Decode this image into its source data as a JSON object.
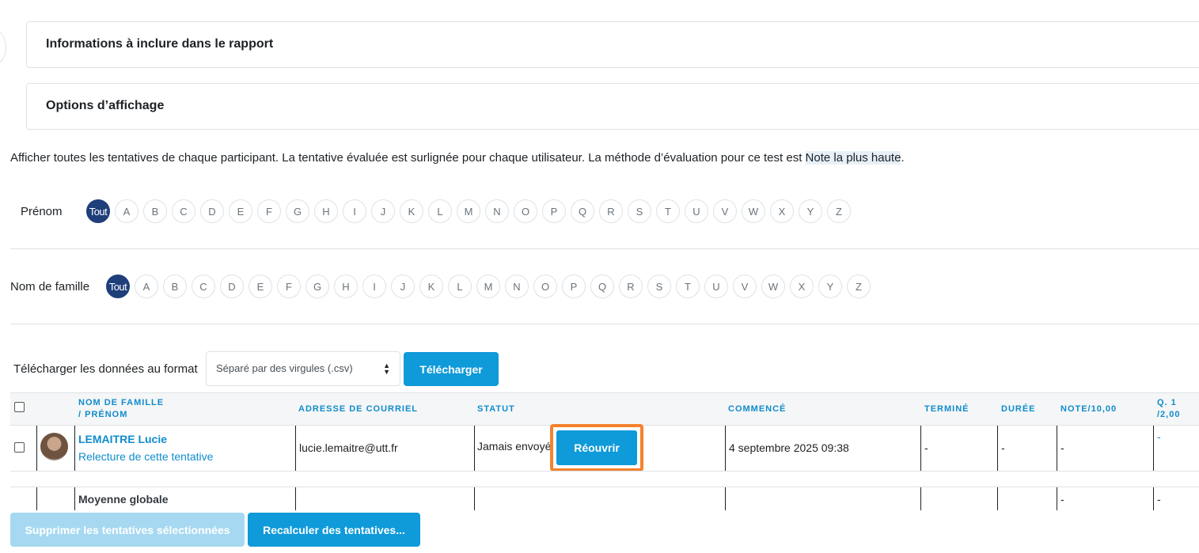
{
  "sections": [
    {
      "title": "Informations à inclure dans le rapport"
    },
    {
      "title": "Options d’affichage"
    }
  ],
  "description": {
    "text": "Afficher toutes les tentatives de chaque participant. La tentative évaluée est surlignée pour chaque utilisateur. La méthode d’évaluation pour ce test est ",
    "highlight": "Note la plus haute",
    "end": "."
  },
  "initials_firstname": {
    "label": "Prénom",
    "all": "Tout",
    "letters": [
      "A",
      "B",
      "C",
      "D",
      "E",
      "F",
      "G",
      "H",
      "I",
      "J",
      "K",
      "L",
      "M",
      "N",
      "O",
      "P",
      "Q",
      "R",
      "S",
      "T",
      "U",
      "V",
      "W",
      "X",
      "Y",
      "Z"
    ]
  },
  "initials_lastname": {
    "label": "Nom de famille",
    "all": "Tout",
    "letters": [
      "A",
      "B",
      "C",
      "D",
      "E",
      "F",
      "G",
      "H",
      "I",
      "J",
      "K",
      "L",
      "M",
      "N",
      "O",
      "P",
      "Q",
      "R",
      "S",
      "T",
      "U",
      "V",
      "W",
      "X",
      "Y",
      "Z"
    ]
  },
  "download": {
    "label": "Télécharger les données au format",
    "format": "Séparé par des virgules (.csv)",
    "button": "Télécharger"
  },
  "table": {
    "headers": {
      "lastname": "NOM DE FAMILLE",
      "firstname": "/ PRÉNOM",
      "email": "ADRESSE DE COURRIEL",
      "status": "STATUT",
      "started": "COMMENCÉ",
      "finished": "TERMINÉ",
      "duration": "DURÉE",
      "grade": "NOTE/10,00",
      "q1_top": "Q. 1",
      "q1_bottom": "/2,00"
    },
    "row": {
      "name": "LEMAITRE Lucie",
      "review": "Relecture de cette tentative",
      "email": "lucie.lemaitre@utt.fr",
      "status": "Jamais envoyé",
      "reopen": "Réouvrir",
      "started": "4 septembre 2025 09:38",
      "finished": "-",
      "duration": "-",
      "grade": "-",
      "q1": "-"
    },
    "average": {
      "label": "Moyenne globale",
      "grade": "-",
      "q1": "-"
    }
  },
  "buttons": {
    "delete": "Supprimer les tentatives sélectionnées",
    "regrade": "Recalculer des tentatives..."
  }
}
